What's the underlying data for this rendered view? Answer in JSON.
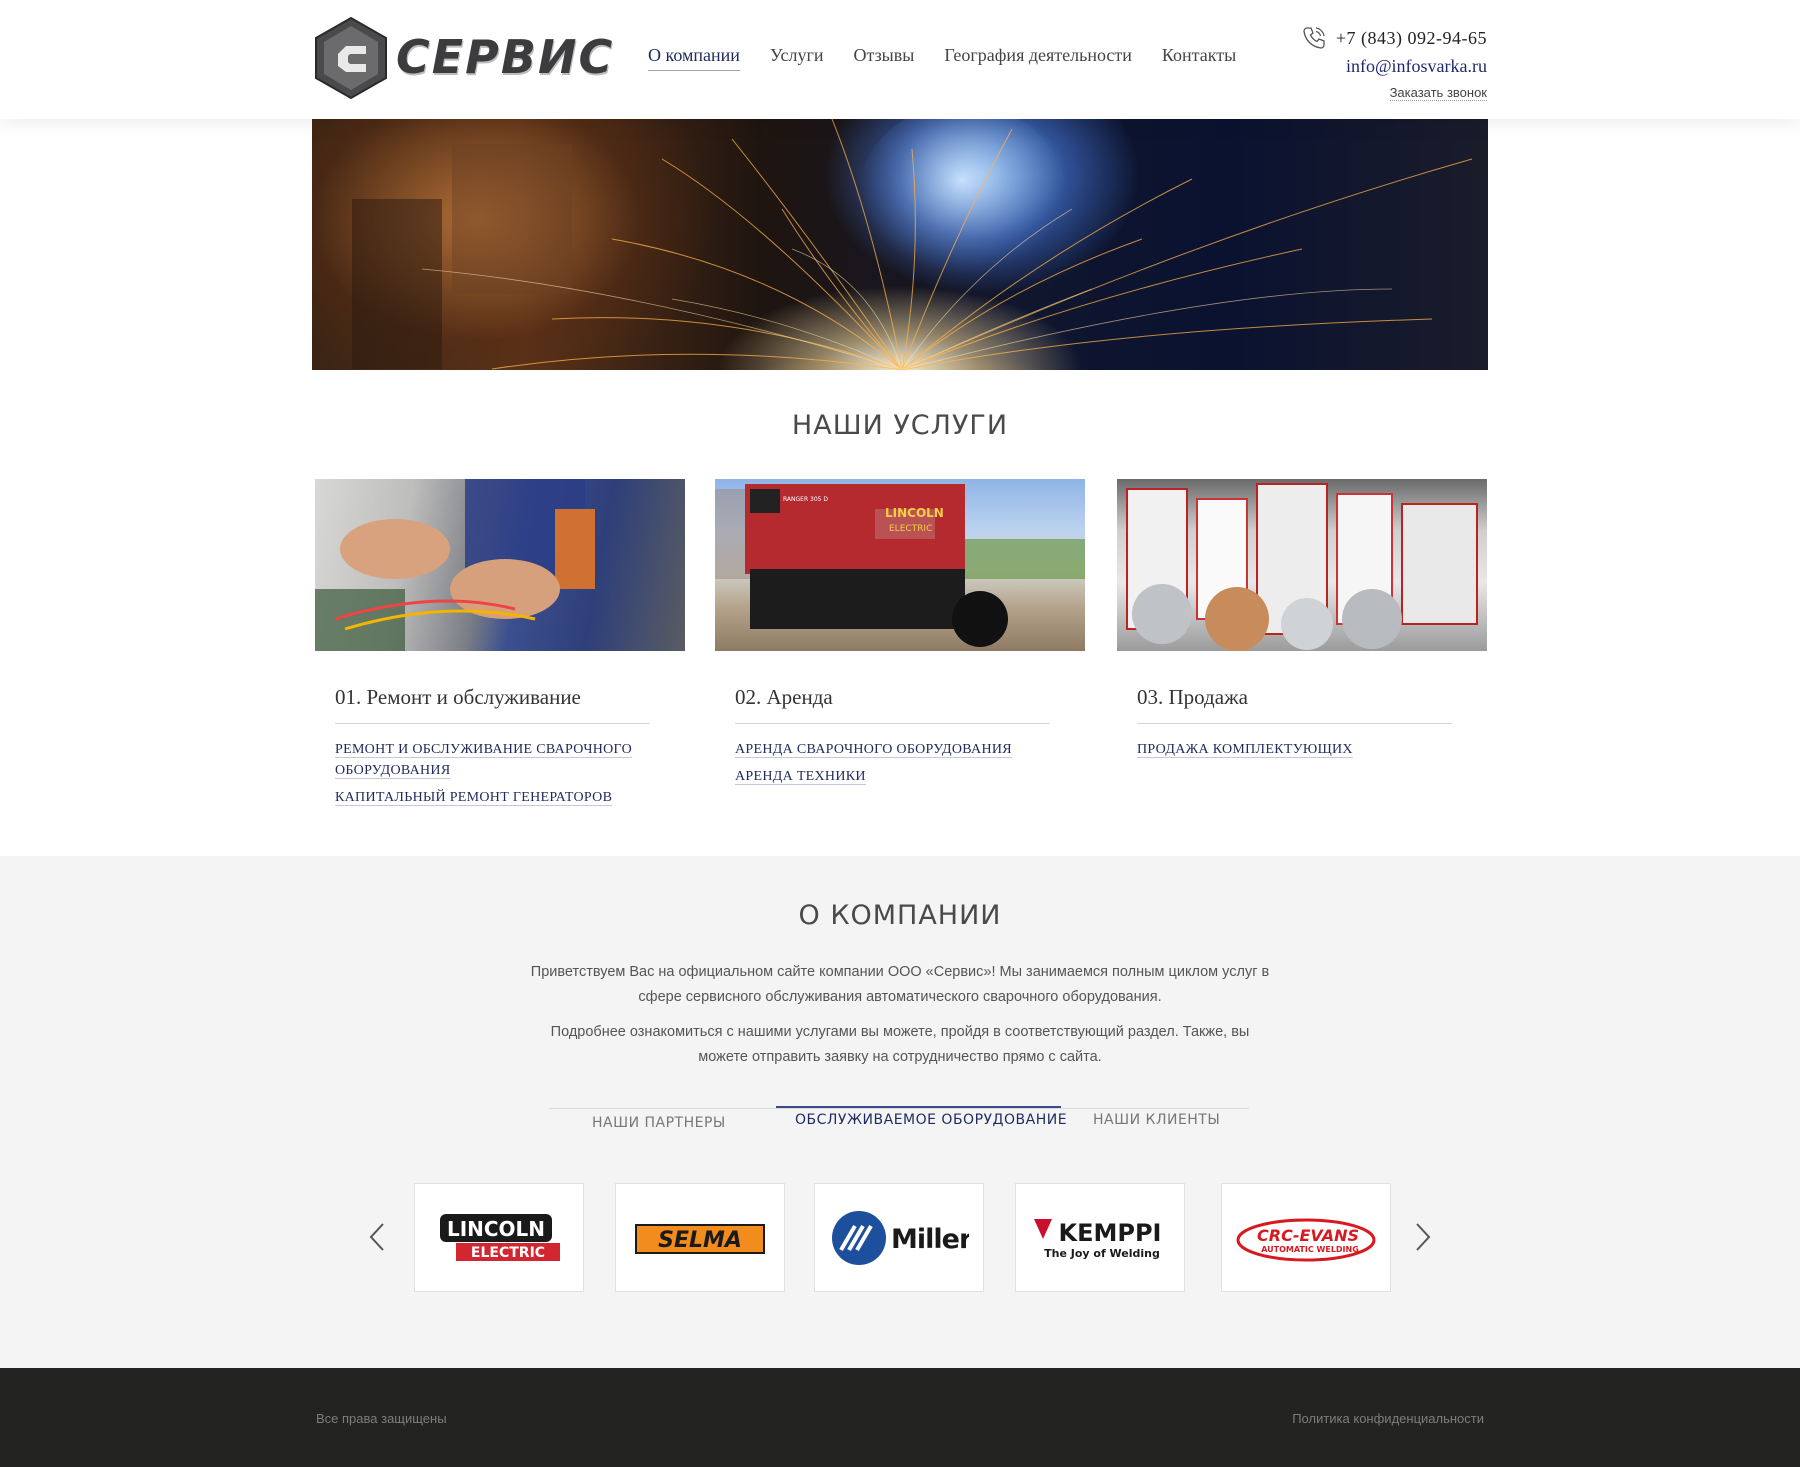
{
  "header": {
    "logo_text": "СЕРВИС",
    "nav": [
      {
        "label": "О компании"
      },
      {
        "label": "Услуги"
      },
      {
        "label": "Отзывы"
      },
      {
        "label": "География деятельности"
      },
      {
        "label": "Контакты"
      }
    ],
    "phone": "+7 (843) 092-94-65",
    "email": "info@infosvarka.ru",
    "callback": "Заказать звонок"
  },
  "services": {
    "title": "НАШИ УСЛУГИ",
    "items": [
      {
        "title": "01. Ремонт и обслуживание",
        "links": [
          "РЕМОНТ И ОБСЛУЖИВАНИЕ СВАРОЧНОГО ОБОРУДОВАНИЯ",
          "КАПИТАЛЬНЫЙ РЕМОНТ ГЕНЕРАТОРОВ"
        ]
      },
      {
        "title": "02. Аренда",
        "links": [
          "АРЕНДА СВАРОЧНОГО ОБОРУДОВАНИЯ",
          "АРЕНДА ТЕХНИКИ"
        ]
      },
      {
        "title": "03. Продажа",
        "links": [
          "ПРОДАЖА КОМПЛЕКТУЮЩИХ"
        ]
      }
    ],
    "image_texts": {
      "generator_brand": "LINCOLN",
      "generator_sub": "ELECTRIC",
      "generator_model": "RANGER 305 D"
    }
  },
  "about": {
    "title": "О КОМПАНИИ",
    "paragraph1_line1": "Приветствуем Вас на официальном сайте компании ООО «Сервис»! Мы занимаемся полным циклом услуг в",
    "paragraph1_line2": "сфере сервисного обслуживания автоматического сварочного оборудования.",
    "paragraph2_line1": "Подробнее ознакомиться с нашими услугами вы можете, пройдя в соответствующий раздел. Также, вы",
    "paragraph2_line2": "можете отправить заявку на сотрудничество прямо с сайта.",
    "tabs": [
      {
        "label": "НАШИ ПАРТНЕРЫ"
      },
      {
        "label": "ОБСЛУЖИВАЕМОЕ ОБОРУДОВАНИЕ"
      },
      {
        "label": "НАШИ КЛИЕНТЫ"
      }
    ],
    "active_tab": "ОБСЛУЖИВАЕМОЕ ОБОРУДОВАНИЕ",
    "brands": [
      {
        "line1": "LINCOLN",
        "line2": "ELECTRIC"
      },
      {
        "line1": "SELMA"
      },
      {
        "line1": "Miller"
      },
      {
        "line1": "KEMPPI",
        "line2": "The Joy of Welding"
      },
      {
        "line1": "CRC-EVANS",
        "line2": "AUTOMATIC WELDING"
      }
    ]
  },
  "footer": {
    "rights": "Все права защищены",
    "privacy": "Политика конфиденциальности"
  },
  "colors": {
    "accent": "#1f2a5e",
    "footer_bg": "#232421",
    "about_bg": "#f4f4f4",
    "lincoln_red": "#d22630",
    "selma_orange": "#f28c1c",
    "miller_blue": "#1d4f9c",
    "kemppi_red": "#c8102e",
    "crc_red": "#d71920"
  },
  "icons": {
    "phone": "phone-icon",
    "prev": "chevron-left-icon",
    "next": "chevron-right-icon"
  }
}
